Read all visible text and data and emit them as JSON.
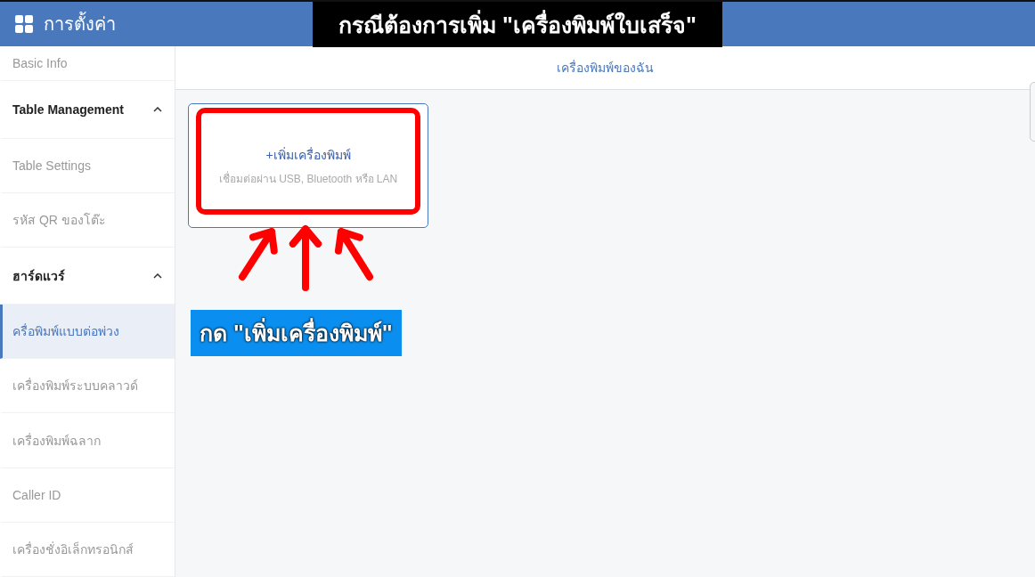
{
  "header": {
    "title": "การตั้งค่า"
  },
  "sidebar": {
    "items": [
      {
        "kind": "item",
        "label": "Basic Info",
        "selected": false
      },
      {
        "kind": "group",
        "label": "Table Management",
        "expanded": true,
        "children": [
          {
            "kind": "item",
            "label": "Table Settings",
            "selected": false
          },
          {
            "kind": "item",
            "label": "รหัส QR ของโต๊ะ",
            "selected": false
          }
        ]
      },
      {
        "kind": "group",
        "label": "ฮาร์ดแวร์",
        "expanded": true,
        "children": [
          {
            "kind": "item",
            "label": "ครื่อพิมพ์แบบต่อพ่วง",
            "selected": true
          },
          {
            "kind": "item",
            "label": "เครื่องพิมพ์ระบบคลาวด์",
            "selected": false
          },
          {
            "kind": "item",
            "label": "เครื่องพิมพ์ฉลาก",
            "selected": false
          },
          {
            "kind": "item",
            "label": "Caller ID",
            "selected": false
          },
          {
            "kind": "item",
            "label": "เครื่องชั่งอิเล็กทรอนิกส์",
            "selected": false
          }
        ]
      }
    ]
  },
  "main": {
    "title": "เครื่องพิมพ์ของฉัน",
    "add_card": {
      "title": "+เพิ่มเครื่องพิมพ์",
      "subtitle": "เชื่อมต่อผ่าน USB, Bluetooth หรือ LAN"
    }
  },
  "annotations": {
    "top_caption": "กรณีต้องการเพิ่ม \"เครื่องพิมพ์ใบเสร็จ\"",
    "bottom_caption": "กด \"เพิ่มเครื่องพิมพ์\""
  }
}
